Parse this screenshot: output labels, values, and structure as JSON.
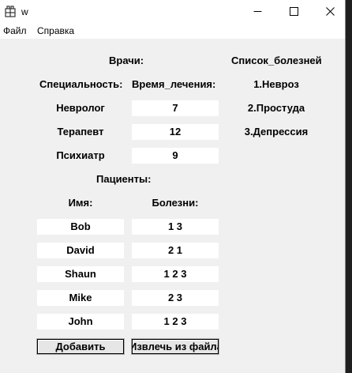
{
  "window": {
    "title": "w"
  },
  "menu": [
    "Файл",
    "Справка"
  ],
  "doctors": {
    "header": "Врачи:",
    "col_specialty": "Специальность:",
    "col_time": "Время_лечения:",
    "rows": [
      {
        "specialty": "Невролог",
        "time": "7"
      },
      {
        "specialty": "Терапевт",
        "time": "12"
      },
      {
        "specialty": "Психиатр",
        "time": "9"
      }
    ]
  },
  "diseases": {
    "header": "Список_болезней",
    "items": [
      "1.Невроз",
      "2.Простуда",
      "3.Депрессия"
    ]
  },
  "patients": {
    "header": "Пациенты:",
    "col_name": "Имя:",
    "col_diseases": "Болезни:",
    "rows": [
      {
        "name": "Bob",
        "diseases": "1 3"
      },
      {
        "name": "David",
        "diseases": "2 1"
      },
      {
        "name": "Shaun",
        "diseases": "1 2 3"
      },
      {
        "name": "Mike",
        "diseases": "2 3"
      },
      {
        "name": "John",
        "diseases": "1 2 3"
      }
    ]
  },
  "buttons": {
    "add": "Добавить",
    "load": "Извлечь из файла"
  }
}
